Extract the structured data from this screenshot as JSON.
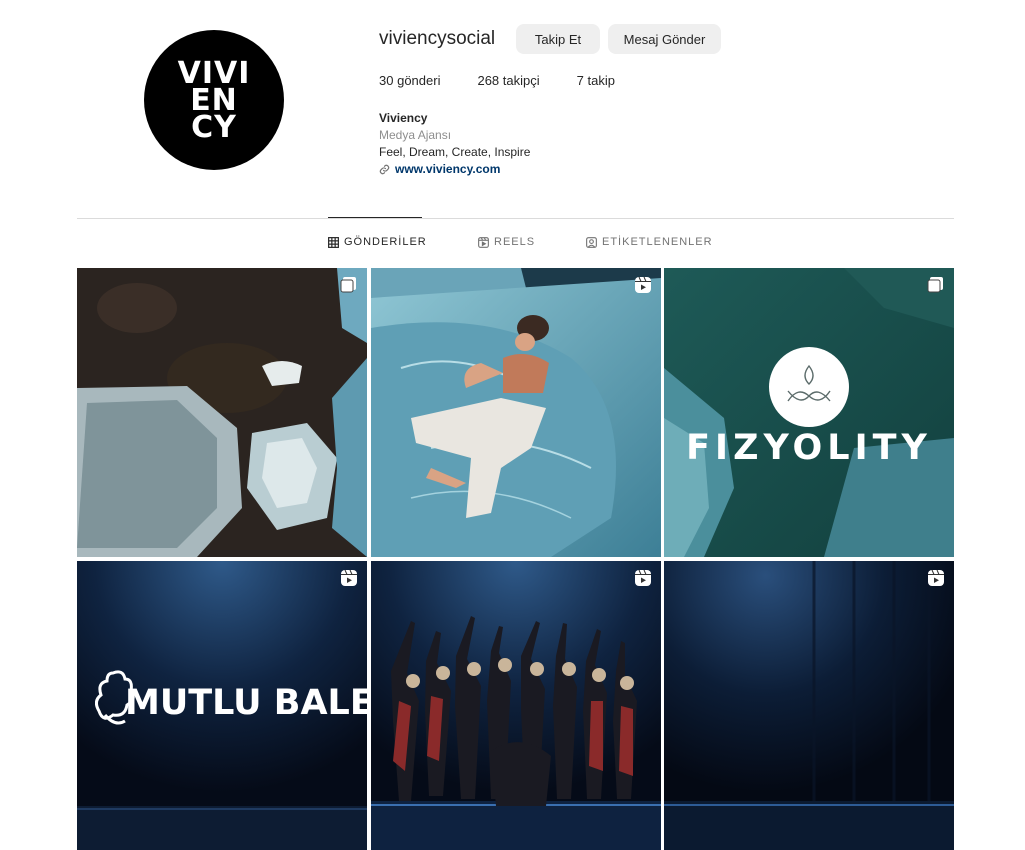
{
  "profile": {
    "username": "viviencysocial",
    "avatar_logo_lines": [
      "VIVI",
      "EN",
      "CY"
    ],
    "follow_label": "Takip Et",
    "message_label": "Mesaj Gönder"
  },
  "stats": {
    "posts": "30",
    "posts_label": "gönderi",
    "followers": "268",
    "followers_label": "takipçi",
    "following": "7",
    "following_label": "takip"
  },
  "bio": {
    "name": "Viviency",
    "category": "Medya Ajansı",
    "text": "Feel, Dream, Create, Inspire",
    "link": "www.viviency.com"
  },
  "tabs": [
    {
      "label": "GÖNDERİLER",
      "icon": "grid-icon",
      "active": true
    },
    {
      "label": "REELS",
      "icon": "reels-icon",
      "active": false
    },
    {
      "label": "ETİKETLENENLER",
      "icon": "tagged-icon",
      "active": false
    }
  ],
  "grid": [
    {
      "badge": "carousel-icon",
      "overlay": ""
    },
    {
      "badge": "reel-icon",
      "overlay": ""
    },
    {
      "badge": "carousel-icon",
      "overlay": "FIZYOLITY"
    },
    {
      "badge": "reel-icon",
      "overlay": "MUTLU BALE"
    },
    {
      "badge": "reel-icon",
      "overlay": ""
    },
    {
      "badge": "reel-icon",
      "overlay": ""
    }
  ],
  "colors": {
    "button_bg": "#efefef",
    "link": "#00376b",
    "muted": "#8e8e8e",
    "divider": "#dbdbdb"
  }
}
